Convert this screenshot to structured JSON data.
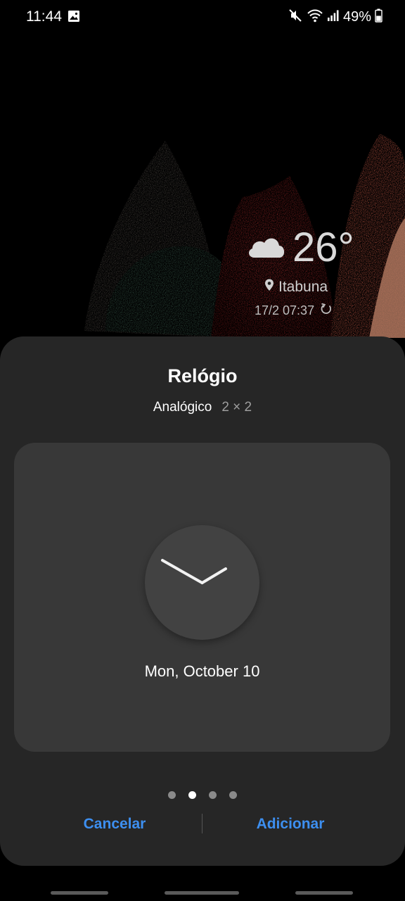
{
  "status_bar": {
    "time": "11:44",
    "battery": "49%",
    "icons": [
      "gallery-icon",
      "mute-icon",
      "wifi-icon",
      "signal-icon",
      "battery-icon"
    ]
  },
  "weather_widget": {
    "temperature": "26°",
    "location": "Itabuna",
    "updated": "17/2 07:37",
    "icons": [
      "cloud-icon",
      "location-pin-icon",
      "refresh-icon"
    ]
  },
  "sheet": {
    "title": "Relógio",
    "widget_style": "Analógico",
    "widget_size": "2 × 2",
    "preview_date": "Mon, October 10",
    "page_count": 4,
    "active_page": 2,
    "cancel_label": "Cancelar",
    "add_label": "Adicionar"
  },
  "colors": {
    "accent": "#3d8ff0",
    "sheet_background": "#262626",
    "preview_background": "#383838"
  }
}
